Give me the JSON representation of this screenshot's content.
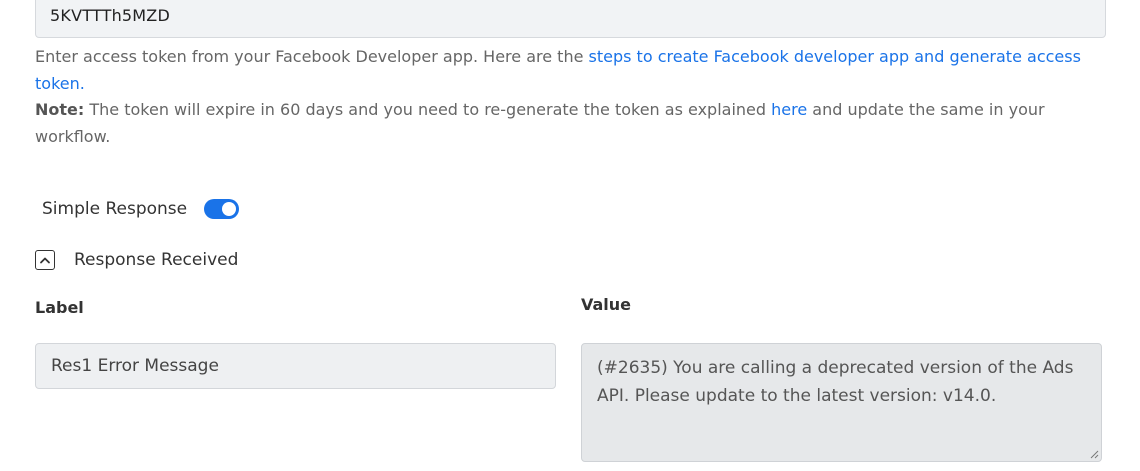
{
  "token": {
    "value": "5KVTTTh5MZD"
  },
  "help": {
    "line1_prefix": "Enter access token from your Facebook Developer app. Here are the ",
    "line1_link": "steps to create Facebook developer app and generate access token.",
    "note_label": "Note:",
    "note_prefix": " The token will expire in 60 days and you need to re-generate the token as explained ",
    "note_link": "here",
    "note_suffix": " and update the same in your workflow."
  },
  "simple_response": {
    "label": "Simple Response",
    "enabled": true
  },
  "response_received": {
    "label": "Response Received",
    "icon": "chevron-up-icon"
  },
  "columns": {
    "label_heading": "Label",
    "value_heading": "Value"
  },
  "row": {
    "label": "Res1 Error Message",
    "value": "(#2635) You are calling a deprecated version of the Ads API. Please update to the latest version: v14.0."
  },
  "colors": {
    "accent": "#1a73e8",
    "field_bg": "#eef0f2",
    "readonly_bg": "#e6e8ea"
  }
}
